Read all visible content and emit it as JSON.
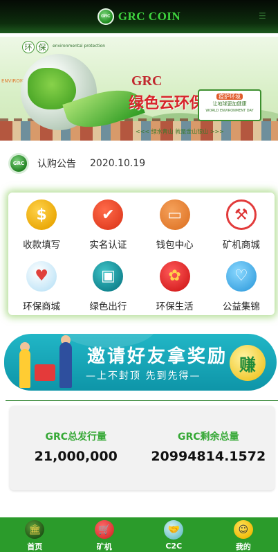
{
  "header": {
    "title": "GRC COIN",
    "logo_text": "GRC",
    "menu_icon": "menu-icon"
  },
  "banner": {
    "env_char_1": "环",
    "env_char_2": "保",
    "env_sub": "environmental protection",
    "brand": "GRC",
    "slogan": "绿色云环保",
    "badge_line1": "疫护环境",
    "badge_line2": "让地球更加健康",
    "badge_line3": "WORLD ENVIRONMENT DAY",
    "subline": "<<< 绿水青山 就是金山银山 >>>",
    "side_text": "ENVIRONMENT DAY"
  },
  "notice": {
    "logo_text": "GRC",
    "label": "认购公告",
    "date": "2020.10.19"
  },
  "menu": {
    "items": [
      {
        "label": "收款填写",
        "icon": "dollar-coin-icon",
        "glyph": "$"
      },
      {
        "label": "实名认证",
        "icon": "verified-user-icon",
        "glyph": "✔"
      },
      {
        "label": "钱包中心",
        "icon": "wallet-card-icon",
        "glyph": "▭"
      },
      {
        "label": "矿机商城",
        "icon": "miner-icon",
        "glyph": "⚒"
      },
      {
        "label": "环保商城",
        "icon": "shop-icon",
        "glyph": "♥"
      },
      {
        "label": "绿色出行",
        "icon": "green-travel-icon",
        "glyph": "▣"
      },
      {
        "label": "环保生活",
        "icon": "eco-life-icon",
        "glyph": "✿"
      },
      {
        "label": "公益集锦",
        "icon": "charity-heart-icon",
        "glyph": "♡"
      }
    ]
  },
  "invite": {
    "title": "邀请好友拿奖励",
    "subtitle": "—上不封顶 先到先得—",
    "earn": "赚"
  },
  "stats": {
    "total_label": "GRC总发行量",
    "total_value": "21,000,000",
    "remaining_label": "GRC剩余总量",
    "remaining_value": "20994814.1572"
  },
  "nav": {
    "items": [
      {
        "label": "首页",
        "icon": "home-bank-icon",
        "glyph": "🏛"
      },
      {
        "label": "矿机",
        "icon": "miner-cart-icon",
        "glyph": "🛒"
      },
      {
        "label": "C2C",
        "icon": "handshake-icon",
        "glyph": "🤝"
      },
      {
        "label": "我的",
        "icon": "profile-avatar-icon",
        "glyph": "☺"
      }
    ]
  }
}
